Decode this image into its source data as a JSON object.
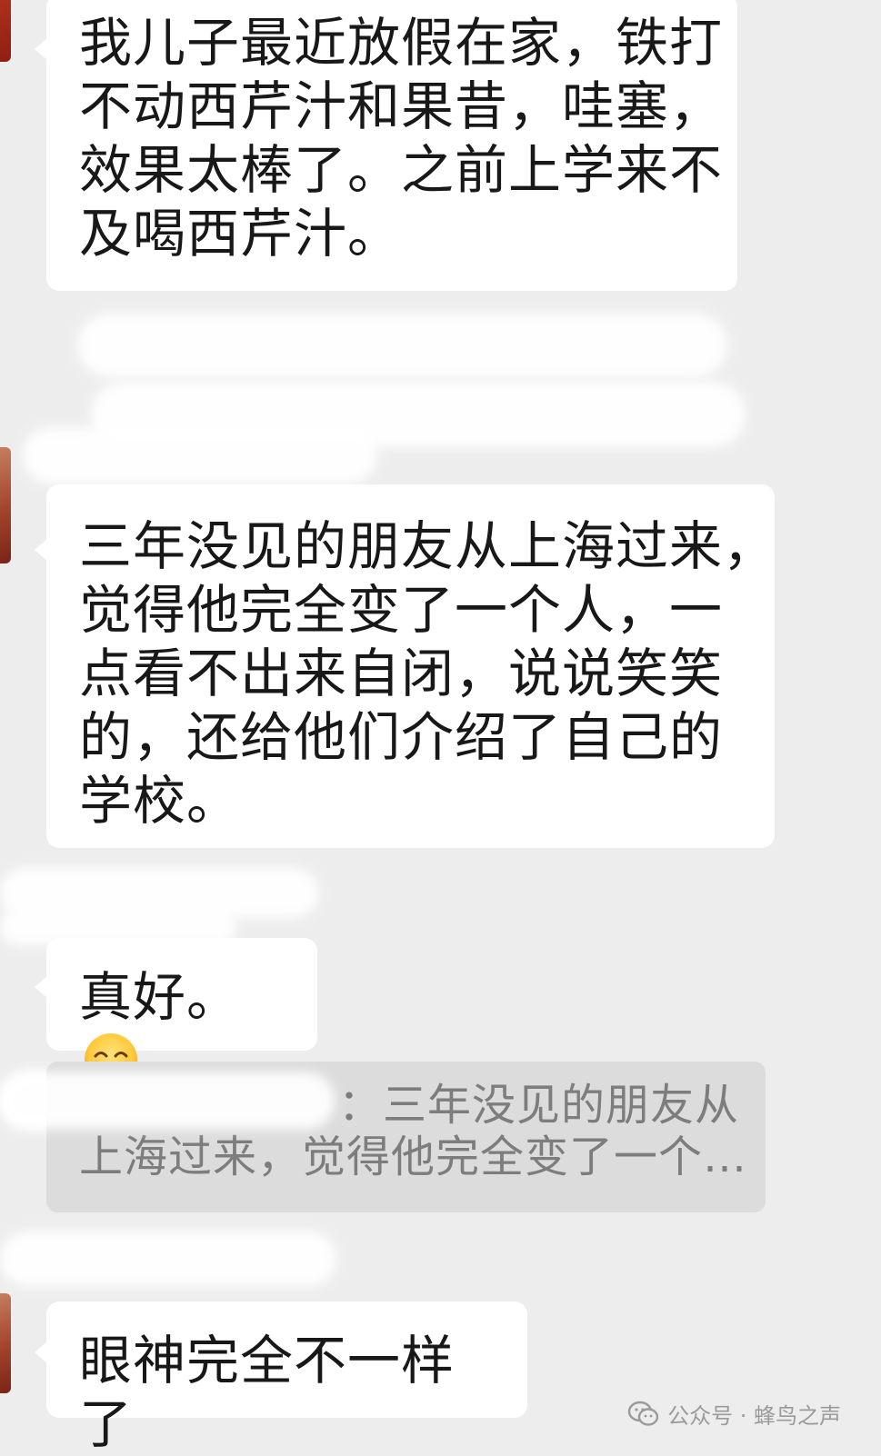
{
  "chat": {
    "messages": [
      {
        "lines": [
          "我儿子最近放假在家，铁打",
          "不动西芹汁和果昔，哇塞，",
          "效果太棒了。之前上学来不",
          "及喝西芹汁。"
        ]
      },
      {
        "lines": [
          "三年没见的朋友从上海过来，",
          "觉得他完全变了一个人，一",
          "点看不出来自闭，说说笑笑",
          "的，还给他们介绍了自己的",
          "学校。"
        ]
      },
      {
        "text": "真好。",
        "emoji": "smiling-blush-emoji"
      },
      {
        "text": "眼神完全不一样了"
      }
    ],
    "quote": {
      "line1_suffix": "：三年没见的朋友从",
      "line2": "上海过来，觉得他完全变了一个…"
    }
  },
  "watermark": {
    "text": "公众号 · 蜂鸟之声",
    "icon": "wechat-icon"
  },
  "colors": {
    "background": "#ededed",
    "bubble": "#ffffff",
    "quote_bg": "#dcdcdc",
    "quote_text": "#7d7d7d"
  }
}
